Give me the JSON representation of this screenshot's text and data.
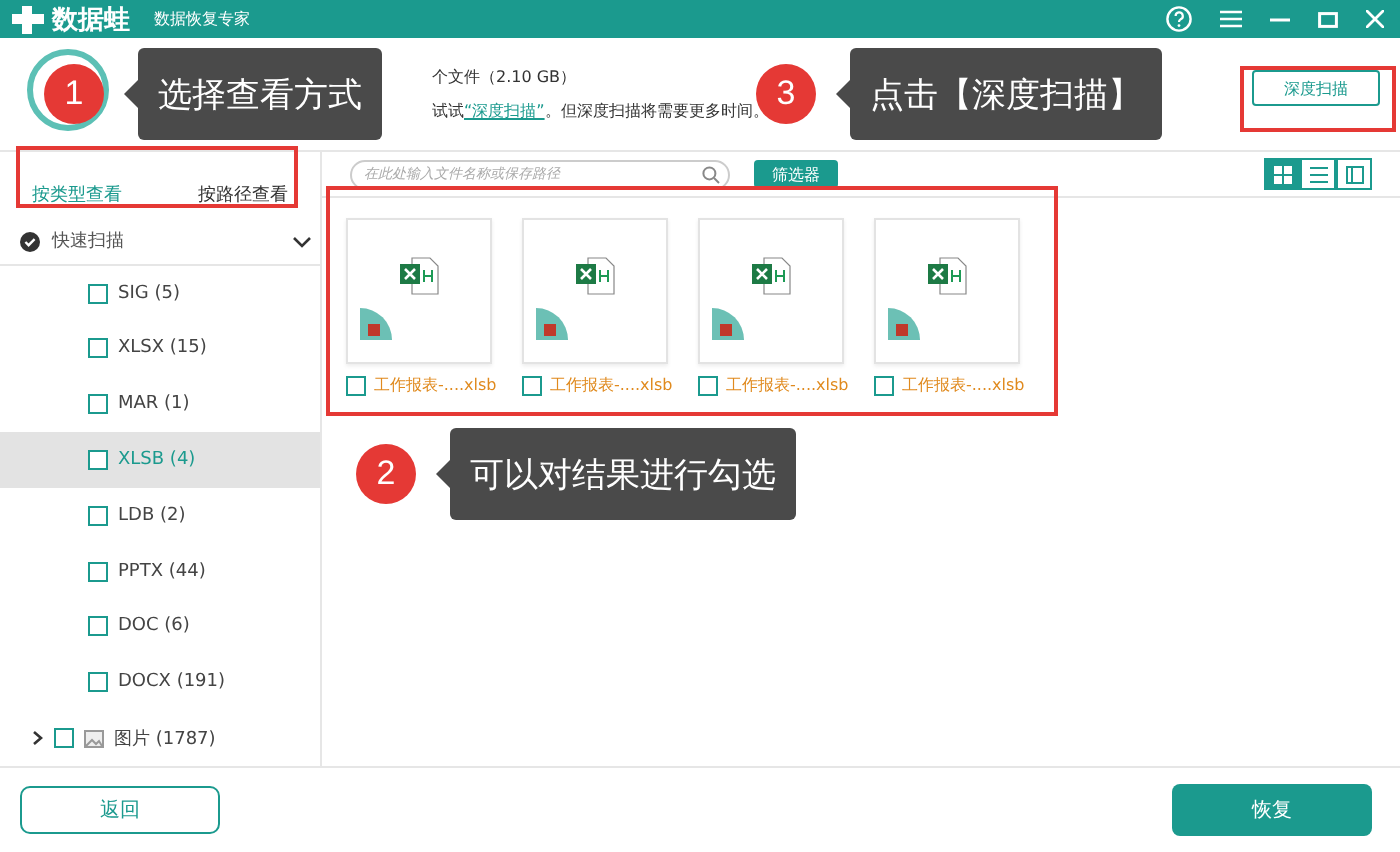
{
  "app": {
    "name": "数据蛙",
    "subtitle": "数据恢复专家"
  },
  "scan_info": {
    "line_1": "个文件（2.10 GB）",
    "line_2_before": "试试",
    "line_2_link": "“深度扫描”",
    "line_2_after": "。但深度扫描将需要更多时间。"
  },
  "deep_scan_button": "深度扫描",
  "view_tabs": [
    {
      "label": "按类型查看",
      "selected": true
    },
    {
      "label": "按路径查看",
      "selected": false
    }
  ],
  "tree": {
    "label": "快速扫描",
    "expanded": true,
    "children": [
      {
        "kind": "type",
        "label": "SIG (5)",
        "checked": false,
        "selected": false
      },
      {
        "kind": "type",
        "label": "XLSX (15)",
        "checked": false,
        "selected": false
      },
      {
        "kind": "type",
        "label": "MAR (1)",
        "checked": false,
        "selected": false
      },
      {
        "kind": "type",
        "label": "XLSB (4)",
        "checked": false,
        "selected": true
      },
      {
        "kind": "type",
        "label": "LDB (2)",
        "checked": false,
        "selected": false
      },
      {
        "kind": "type",
        "label": "PPTX (44)",
        "checked": false,
        "selected": false
      },
      {
        "kind": "type",
        "label": "DOC (6)",
        "checked": false,
        "selected": false
      },
      {
        "kind": "type",
        "label": "DOCX (191)",
        "checked": false,
        "selected": false
      },
      {
        "kind": "folder",
        "label": "图片 (1787)",
        "checked": false,
        "selected": false,
        "expanded": false
      }
    ]
  },
  "search": {
    "placeholder": "在此处输入文件名称或保存路径"
  },
  "filter_button": "筛选器",
  "view_modes": [
    {
      "kind": "grid",
      "selected": true
    },
    {
      "kind": "list",
      "selected": false
    },
    {
      "kind": "detail",
      "selected": false
    }
  ],
  "files": [
    {
      "name": "工作报表-....xlsb",
      "checked": false
    },
    {
      "name": "工作报表-....xlsb",
      "checked": false
    },
    {
      "name": "工作报表-....xlsb",
      "checked": false
    },
    {
      "name": "工作报表-....xlsb",
      "checked": false
    }
  ],
  "back_button": "返回",
  "recover_button": "恢复",
  "callouts": [
    {
      "number": "1",
      "text": "选择查看方式"
    },
    {
      "number": "2",
      "text": "可以对结果进行勾选"
    },
    {
      "number": "3",
      "text": "点击【深度扫描】"
    }
  ]
}
